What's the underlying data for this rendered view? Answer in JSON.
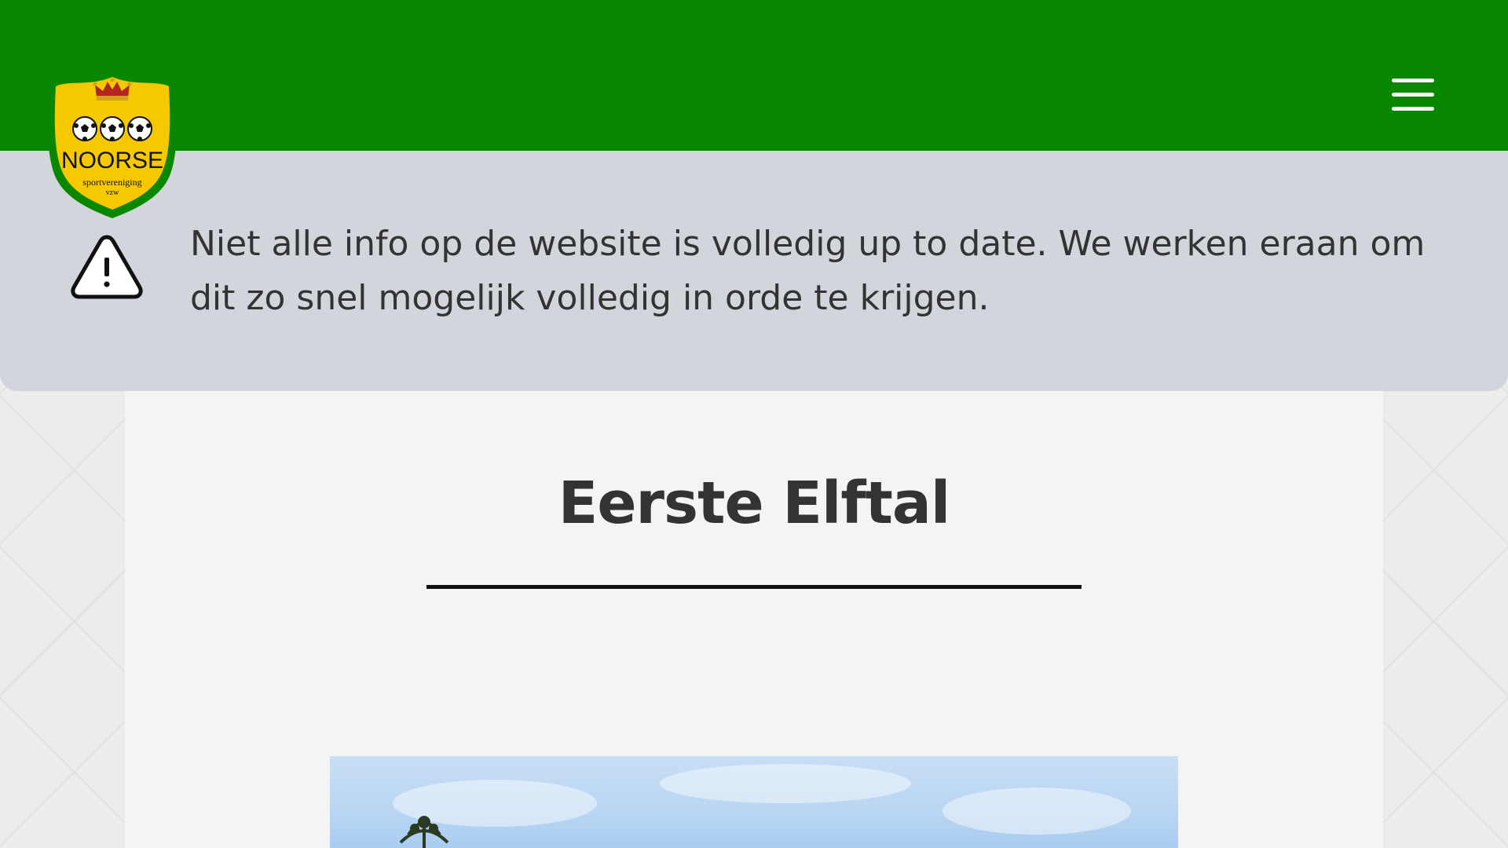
{
  "header": {
    "logo": {
      "club_name": "NOORSE",
      "subtitle": "sportvereniging",
      "legal_form": "vzw"
    },
    "menu_icon": "hamburger-menu-icon"
  },
  "notice": {
    "icon": "warning-triangle-icon",
    "text": "Niet alle info op de website is volledig up to date. We werken eraan om dit zo snel mogelijk volledig in orde te krijgen."
  },
  "main": {
    "title": "Eerste Elftal"
  },
  "colors": {
    "header_green": "#0a8700",
    "notice_bg": "#d2d5dc",
    "logo_yellow": "#f5c800",
    "text_dark": "#333333"
  }
}
